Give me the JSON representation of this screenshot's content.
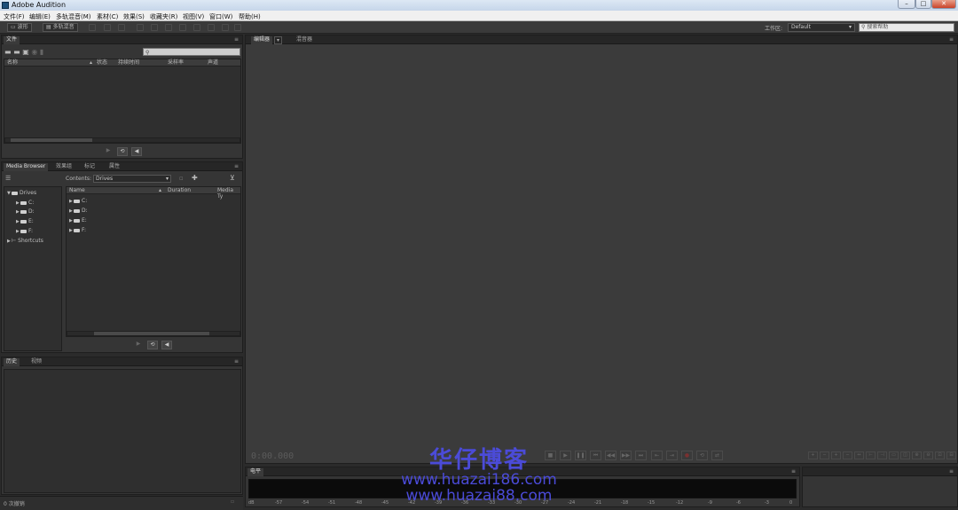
{
  "window": {
    "title": "Adobe Audition"
  },
  "window_buttons": {
    "minimize": "–",
    "maximize": "□",
    "close": "✕"
  },
  "menu": [
    "文件(F)",
    "编辑(E)",
    "多轨混音(M)",
    "素材(C)",
    "效果(S)",
    "收藏夹(R)",
    "视图(V)",
    "窗口(W)",
    "帮助(H)"
  ],
  "toolbar": {
    "waveform_label": "波形",
    "multitrack_label": "多轨混音",
    "workspace_label": "工作区:",
    "workspace_value": "Default",
    "help_search_placeholder": "搜索帮助"
  },
  "files_panel": {
    "tab": "文件",
    "columns": [
      "名称",
      "状态",
      "持续时间",
      "采样率",
      "声道"
    ]
  },
  "media_browser": {
    "tabs": [
      "Media Browser",
      "效果组",
      "标记",
      "属性"
    ],
    "contents_label": "Contents:",
    "contents_value": "Drives",
    "tree": [
      {
        "label": "Drives",
        "level": 0,
        "expanded": true
      },
      {
        "label": "C:",
        "level": 1
      },
      {
        "label": "D:",
        "level": 1
      },
      {
        "label": "E:",
        "level": 1
      },
      {
        "label": "F:",
        "level": 1
      },
      {
        "label": "Shortcuts",
        "level": 0
      }
    ],
    "columns": [
      "Name",
      "Duration",
      "Media Ty"
    ],
    "items": [
      "C:",
      "D:",
      "E:",
      "F:"
    ]
  },
  "history_panel": {
    "tabs": [
      "历史",
      "视频"
    ]
  },
  "editor": {
    "tabs": [
      "编辑器",
      "混音器"
    ],
    "time": "0:00.000"
  },
  "levels_panel": {
    "tab": "电平",
    "scale": [
      "dB",
      "-57",
      "-54",
      "-51",
      "-48",
      "-45",
      "-42",
      "-39",
      "-36",
      "-33",
      "-30",
      "-27",
      "-24",
      "-21",
      "-18",
      "-15",
      "-12",
      "-9",
      "-6",
      "-3",
      "0"
    ]
  },
  "status": {
    "text": "0 次撤销"
  },
  "watermark": {
    "title": "华仔博客",
    "url1": "www.huazai186.com",
    "url2": "www.huazai88.com"
  }
}
